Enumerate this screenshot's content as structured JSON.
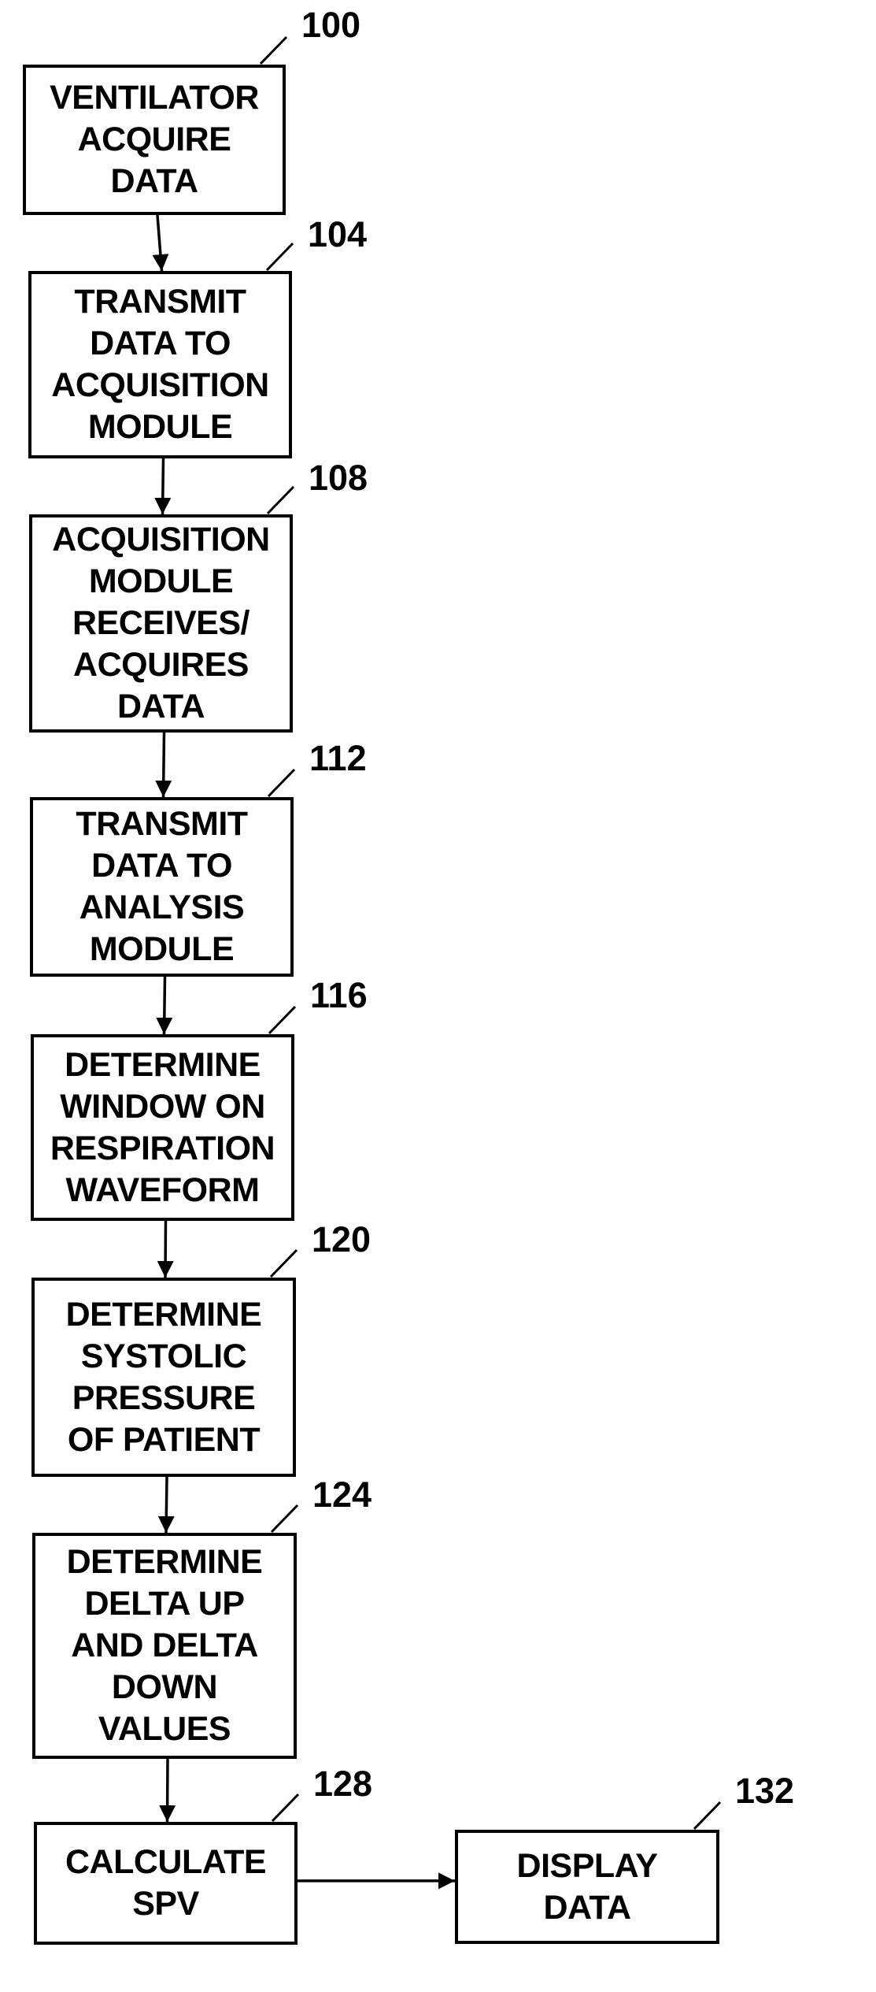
{
  "diagram": {
    "type": "flowchart",
    "steps": [
      {
        "ref": "100",
        "lines": [
          "VENTILATOR",
          "ACQUIRE",
          "DATA"
        ]
      },
      {
        "ref": "104",
        "lines": [
          "TRANSMIT",
          "DATA TO",
          "ACQUISITION",
          "MODULE"
        ]
      },
      {
        "ref": "108",
        "lines": [
          "ACQUISITION",
          "MODULE",
          "RECEIVES/",
          "ACQUIRES",
          "DATA"
        ]
      },
      {
        "ref": "112",
        "lines": [
          "TRANSMIT",
          "DATA TO",
          "ANALYSIS",
          "MODULE"
        ]
      },
      {
        "ref": "116",
        "lines": [
          "DETERMINE",
          "WINDOW ON",
          "RESPIRATION",
          "WAVEFORM"
        ]
      },
      {
        "ref": "120",
        "lines": [
          "DETERMINE",
          "SYSTOLIC",
          "PRESSURE",
          "OF PATIENT"
        ]
      },
      {
        "ref": "124",
        "lines": [
          "DETERMINE",
          "DELTA UP",
          "AND DELTA",
          "DOWN",
          "VALUES"
        ]
      },
      {
        "ref": "128",
        "lines": [
          "CALCULATE",
          "SPV"
        ]
      },
      {
        "ref": "132",
        "lines": [
          "DISPLAY",
          "DATA"
        ]
      }
    ],
    "edges": [
      [
        "100",
        "104"
      ],
      [
        "104",
        "108"
      ],
      [
        "108",
        "112"
      ],
      [
        "112",
        "116"
      ],
      [
        "116",
        "120"
      ],
      [
        "120",
        "124"
      ],
      [
        "124",
        "128"
      ],
      [
        "128",
        "132"
      ]
    ]
  }
}
